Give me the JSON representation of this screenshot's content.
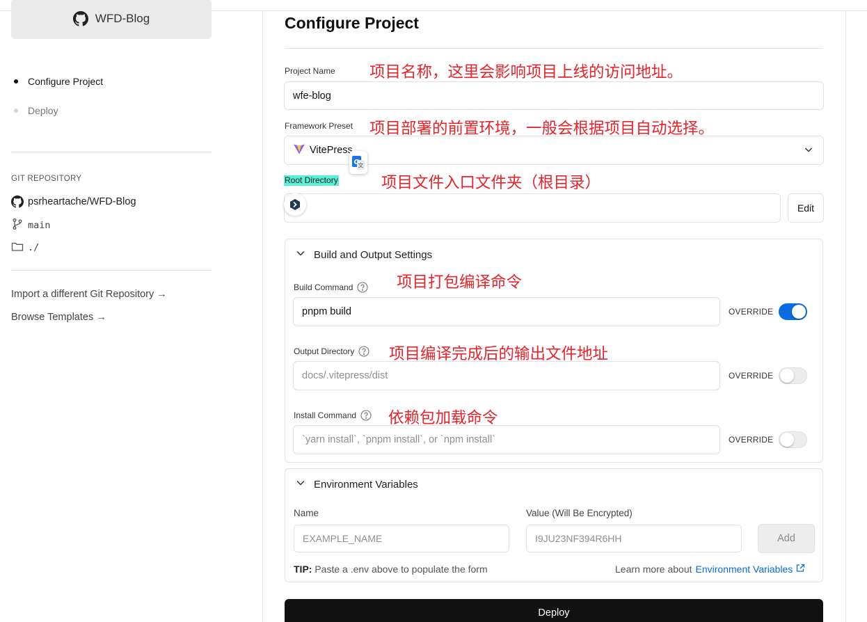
{
  "sidebar": {
    "repo_name": "WFD-Blog",
    "steps": [
      {
        "label": "Configure Project",
        "active": true
      },
      {
        "label": "Deploy",
        "active": false
      }
    ],
    "git_heading": "GIT REPOSITORY",
    "repo_full_name": "psrheartache/WFD-Blog",
    "branch": "main",
    "root_path": "./",
    "import_link": "Import a different Git Repository →",
    "templates_link": "Browse Templates →"
  },
  "main": {
    "title": "Configure Project",
    "project_name": {
      "label": "Project Name",
      "value": "wfe-blog",
      "annotation": "项目名称，这里会影响项目上线的访问地址。"
    },
    "framework_preset": {
      "label": "Framework Preset",
      "value": "VitePress",
      "annotation": "项目部署的前置环境，一般会根据项目自动选择。"
    },
    "root_directory": {
      "label": "Root Directory",
      "value": "",
      "edit_label": "Edit",
      "annotation": "项目文件入口文件夹（根目录）"
    },
    "build_settings": {
      "heading": "Build and Output Settings",
      "build_command": {
        "label": "Build Command",
        "value": "pnpm build",
        "override_label": "OVERRIDE",
        "override_on": true,
        "annotation": "项目打包编译命令"
      },
      "output_directory": {
        "label": "Output Directory",
        "placeholder": "docs/.vitepress/dist",
        "override_label": "OVERRIDE",
        "override_on": false,
        "annotation": "项目编译完成后的输出文件地址"
      },
      "install_command": {
        "label": "Install Command",
        "placeholder": "`yarn install`, `pnpm install`, or `npm install`",
        "override_label": "OVERRIDE",
        "override_on": false,
        "annotation": "依赖包加载命令"
      }
    },
    "env_vars": {
      "heading": "Environment Variables",
      "name_label": "Name",
      "name_placeholder": "EXAMPLE_NAME",
      "value_label": "Value (Will Be Encrypted)",
      "value_placeholder": "I9JU23NF394R6HH",
      "add_label": "Add",
      "tip_bold": "TIP:",
      "tip_text": " Paste a .env above to populate the form",
      "learn_prefix": "Learn more about",
      "learn_link": "Environment Variables"
    },
    "deploy_label": "Deploy"
  },
  "colors": {
    "accent_blue": "#0a6ddf",
    "annotation_red": "#e8232a",
    "highlight_cyan": "#58f0d6",
    "deploy_black": "#111111"
  }
}
